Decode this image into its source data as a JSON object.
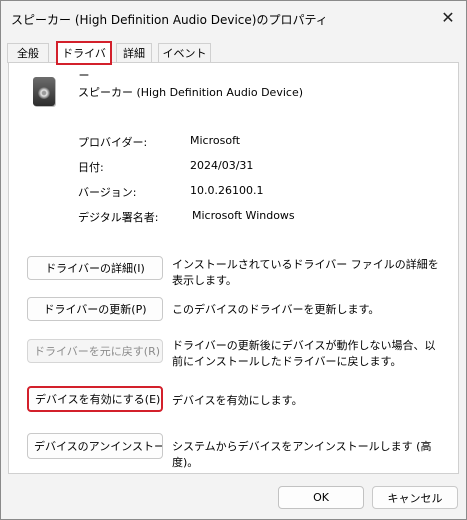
{
  "window": {
    "title": "スピーカー (High Definition Audio Device)のプロパティ",
    "close_glyph": "✕"
  },
  "tabs": [
    {
      "label": "全般",
      "selected": false
    },
    {
      "label": "ドライバー",
      "selected": true
    },
    {
      "label": "詳細",
      "selected": false
    },
    {
      "label": "イベント",
      "selected": false
    }
  ],
  "device": {
    "icon": "speaker-icon",
    "name": "スピーカー (High Definition Audio Device)"
  },
  "info": [
    {
      "label": "プロバイダー:",
      "value": "Microsoft"
    },
    {
      "label": "日付:",
      "value": "2024/03/31"
    },
    {
      "label": "バージョン:",
      "value": "10.0.26100.1"
    },
    {
      "label": "デジタル署名者:",
      "value": "Microsoft Windows"
    }
  ],
  "actions": [
    {
      "button": "ドライバーの詳細(I)",
      "description": "インストールされているドライバー ファイルの詳細を表示します。",
      "enabled": true,
      "highlighted": false
    },
    {
      "button": "ドライバーの更新(P)",
      "description": "このデバイスのドライバーを更新します。",
      "enabled": true,
      "highlighted": false
    },
    {
      "button": "ドライバーを元に戻す(R)",
      "description": "ドライバーの更新後にデバイスが動作しない場合、以前にインストールしたドライバーに戻します。",
      "enabled": false,
      "highlighted": false
    },
    {
      "button": "デバイスを有効にする(E)",
      "description": "デバイスを有効にします。",
      "enabled": true,
      "highlighted": true
    },
    {
      "button": "デバイスのアンインストール(U)",
      "description": "システムからデバイスをアンインストールします (高度)。",
      "enabled": true,
      "highlighted": false
    }
  ],
  "footer": {
    "ok_label": "OK",
    "cancel_label": "キャンセル"
  },
  "colors": {
    "highlight": "#d3202b",
    "panel_background": "#ffffff",
    "window_background": "#f3f3f3"
  }
}
